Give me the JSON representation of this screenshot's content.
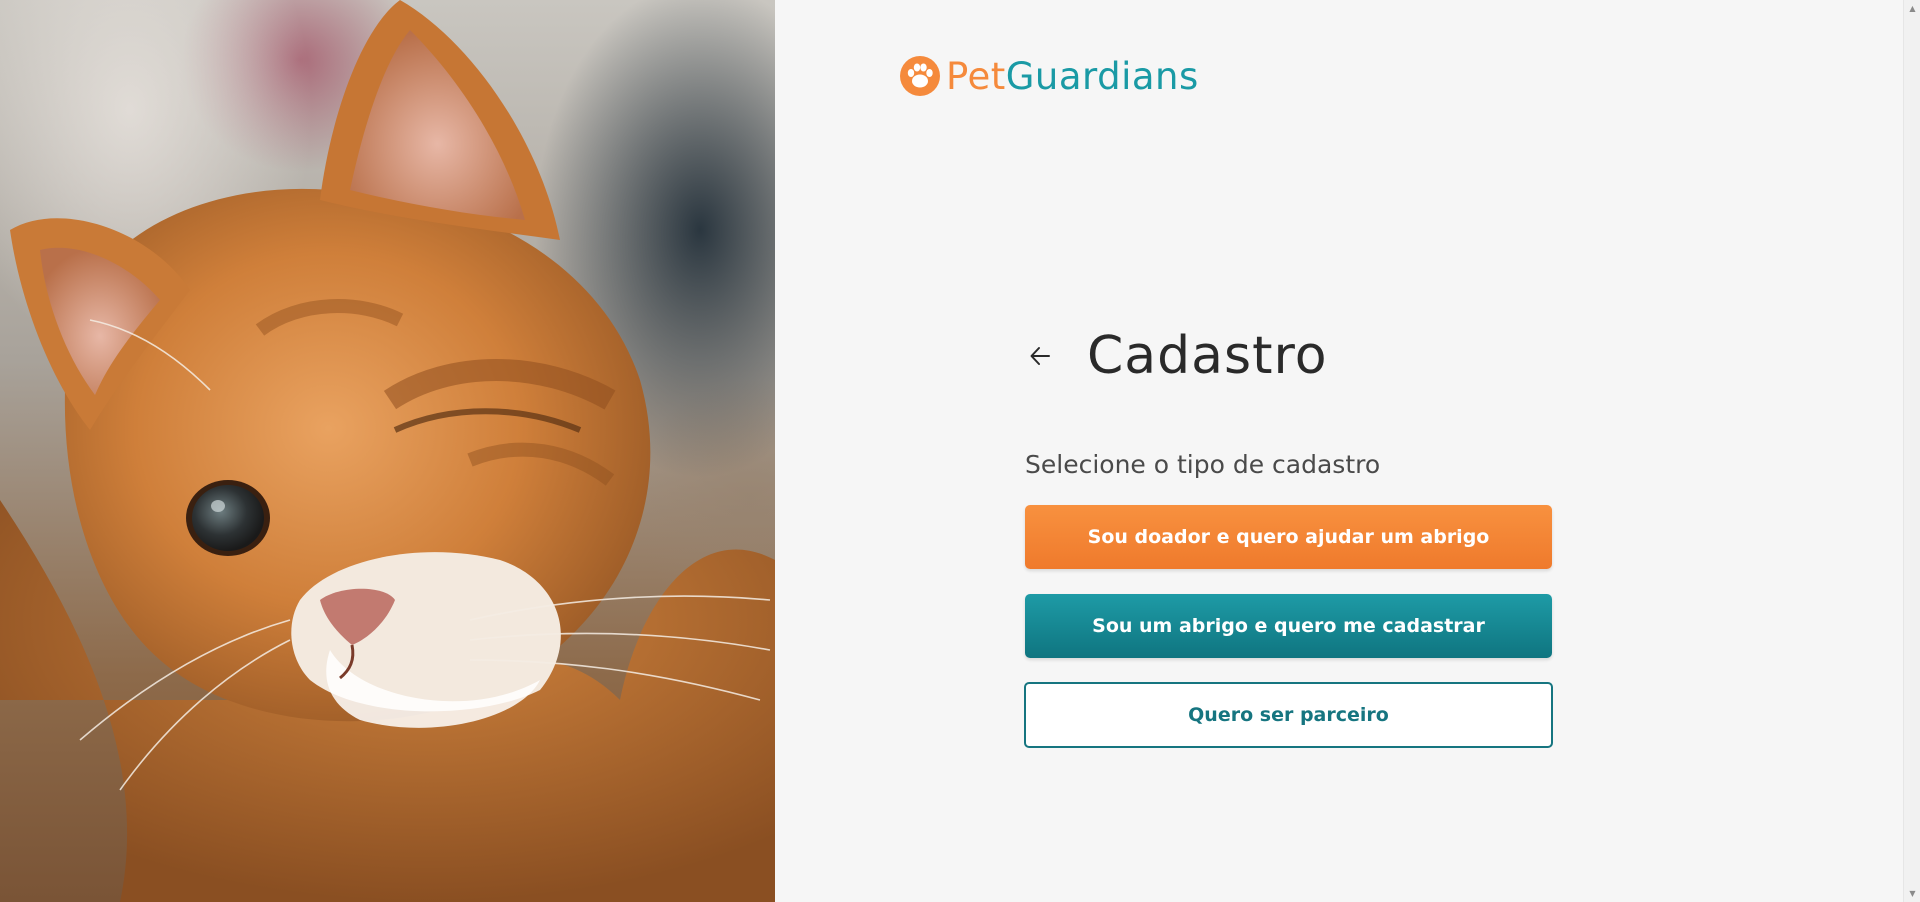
{
  "brand": {
    "name_part1": "Pet",
    "name_part2": "Guardians",
    "color_primary": "#f58a3c",
    "color_secondary": "#1a9aa5",
    "icon": "paw-icon"
  },
  "hero_image": {
    "icon": "cat-photo"
  },
  "form": {
    "back_icon": "arrow-left-icon",
    "title": "Cadastro",
    "subtitle": "Selecione o tipo de cadastro",
    "options": [
      {
        "label": "Sou doador e quero ajudar um abrigo",
        "color": "#f58a3c"
      },
      {
        "label": "Sou um abrigo e quero me cadastrar",
        "color": "#157f89"
      },
      {
        "label": "Quero ser parceiro",
        "color": "#167580"
      }
    ]
  }
}
